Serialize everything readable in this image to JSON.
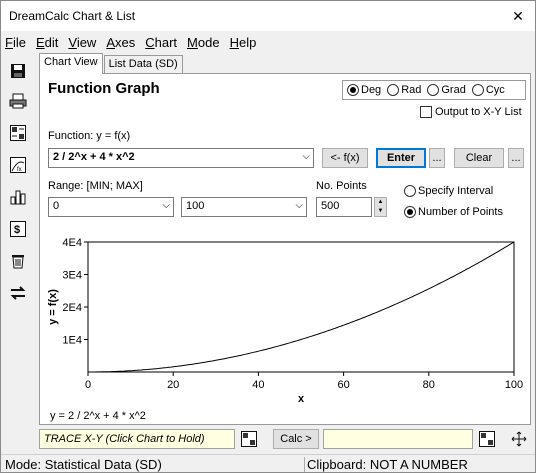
{
  "window": {
    "title": "DreamCalc Chart & List",
    "close_glyph": "✕"
  },
  "menu": [
    "File",
    "Edit",
    "View",
    "Axes",
    "Chart",
    "Mode",
    "Help"
  ],
  "tabs": {
    "chart_view": "Chart View",
    "list_data": "List Data (SD)"
  },
  "panel": {
    "heading": "Function Graph",
    "angle_modes": [
      "Deg",
      "Rad",
      "Grad",
      "Cyc"
    ],
    "angle_selected": "Deg",
    "output_checkbox": "Output to X-Y List",
    "function_label": "Function: y = f(x)",
    "function_value": "2 / 2^x + 4 * x^2",
    "fx_button": "<- f(x)",
    "enter_button": "Enter",
    "ellipsis": "...",
    "clear_button": "Clear",
    "range_label": "Range: [MIN; MAX]",
    "range_min": "0",
    "range_max": "100",
    "points_label": "No. Points",
    "points_value": "500",
    "interval_options": [
      "Specify Interval",
      "Number of Points"
    ],
    "interval_selected": "Number of Points",
    "equation_caption": "y = 2 / 2^x + 4 * x^2"
  },
  "chart_data": {
    "type": "line",
    "function": "2 / 2^x + 4 * x^2",
    "xlabel": "x",
    "ylabel": "y = f(x)",
    "xlim": [
      0,
      100
    ],
    "ylim": [
      0,
      40000
    ],
    "x_ticks": [
      0,
      20,
      40,
      60,
      80,
      100
    ],
    "y_ticks": [
      10000,
      20000,
      30000,
      40000
    ],
    "y_tick_labels": [
      "1E4",
      "2E4",
      "3E4",
      "4E4"
    ],
    "x_tick_labels": [
      "0",
      "20",
      "40",
      "60",
      "80",
      "100"
    ],
    "grid": false
  },
  "bottom": {
    "trace_text": "TRACE X-Y (Click Chart to Hold)",
    "calc_button": "Calc >"
  },
  "status": {
    "mode": "Mode: Statistical Data (SD)",
    "clipboard": "Clipboard: NOT A NUMBER"
  },
  "icons": [
    "save-icon",
    "print-icon",
    "calculator-icon",
    "function-chart-icon",
    "bar-chart-icon",
    "currency-icon",
    "trash-icon",
    "swap-icon",
    "move-icon"
  ]
}
